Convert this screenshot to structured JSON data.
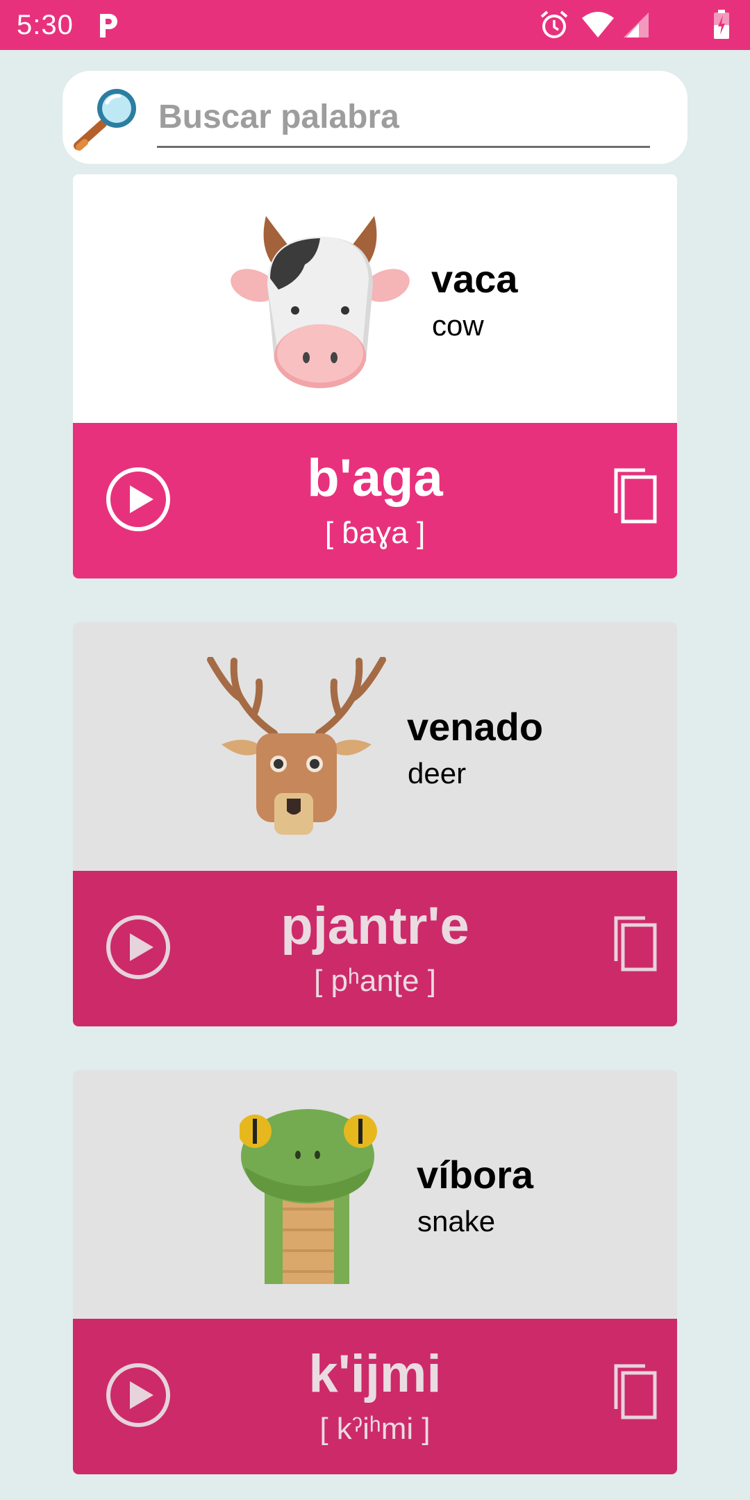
{
  "status_bar": {
    "time": "5:30",
    "icons": [
      "p-app-icon",
      "alarm-icon",
      "wifi-icon",
      "signal-icon",
      "battery-icon"
    ]
  },
  "search": {
    "placeholder": "Buscar palabra",
    "value": "",
    "icon": "magnifier-icon"
  },
  "colors": {
    "accent": "#e8317c",
    "accent_dim": "#cd2a6a",
    "card_active_bg": "#ffffff",
    "card_inactive_bg": "#e2e2e2",
    "background": "#e1ecec"
  },
  "cards": [
    {
      "spanish": "vaca",
      "english": "cow",
      "native": "b'aga",
      "ipa": "[ ɓaɣa ]",
      "image": "cow-icon",
      "active": true
    },
    {
      "spanish": "venado",
      "english": "deer",
      "native": "pjantr'e",
      "ipa": "[ pʰanʈe ]",
      "image": "deer-icon",
      "active": false
    },
    {
      "spanish": "víbora",
      "english": "snake",
      "native": "k'ijmi",
      "ipa": "[ kˀiʰmi ]",
      "image": "snake-icon",
      "active": false
    }
  ]
}
